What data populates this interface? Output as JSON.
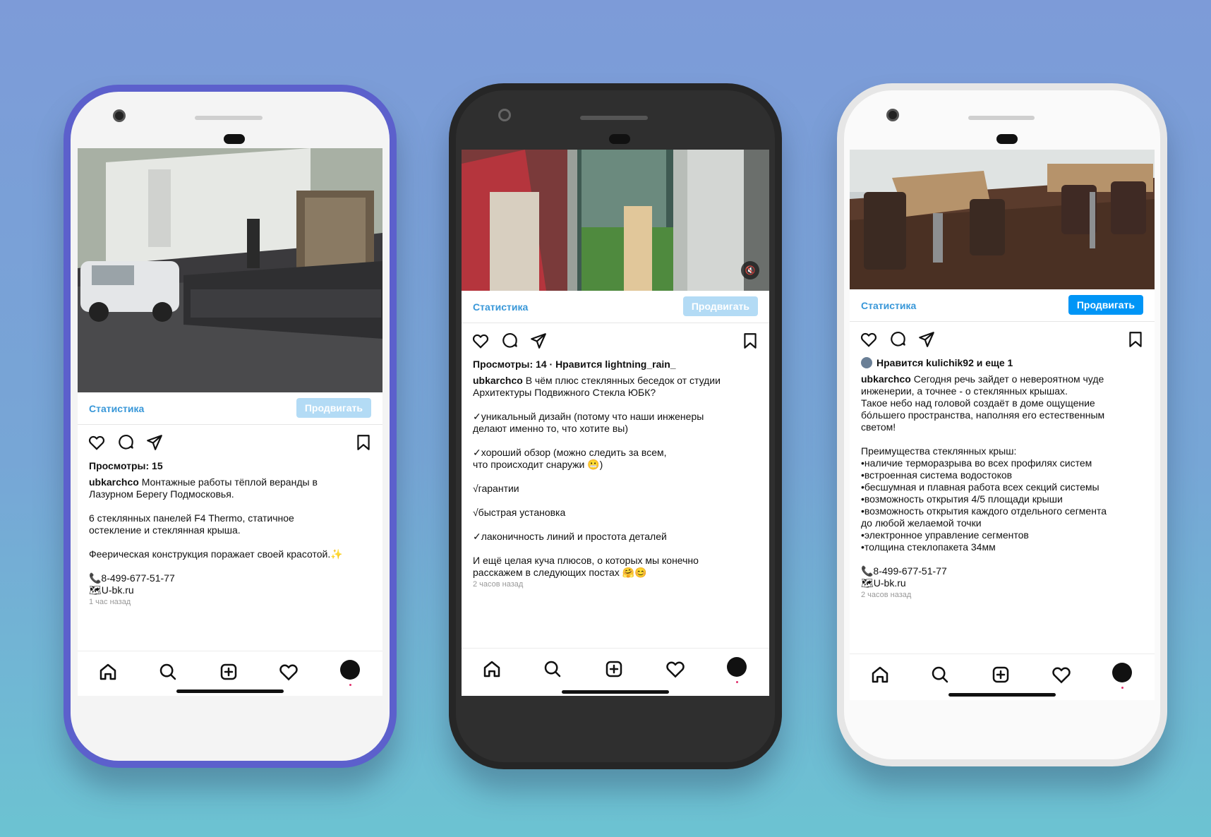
{
  "phones": [
    {
      "stat_label": "Статистика",
      "promote_label": "Продвигать",
      "views": "Просмотры: 15",
      "caption": [
        {
          "user": "ubkarchco",
          "text": " Монтажные работы тёплой веранды в"
        },
        {
          "text": "Лазурном Берегу Подмосковья."
        },
        {
          "text": ""
        },
        {
          "text": "6 стеклянных панелей F4 Thermo, статичное"
        },
        {
          "text": "остекление и стеклянная крыша."
        },
        {
          "text": ""
        },
        {
          "text": "Феерическая конструкция поражает своей красотой.✨"
        },
        {
          "text": ""
        },
        {
          "text": "📞8-499-677-51-77"
        },
        {
          "text": "🗺U-bk.ru"
        }
      ],
      "time": "1 час назад"
    },
    {
      "stat_label": "Статистика",
      "promote_label": "Продвигать",
      "views": "Просмотры: 14 · Нравится lightning_rain_",
      "caption": [
        {
          "user": "ubkarchco",
          "text": " В чём плюс стеклянных беседок от студии"
        },
        {
          "text": "Архитектуры Подвижного Стекла ЮБК?"
        },
        {
          "text": ""
        },
        {
          "text": "✓уникальный дизайн (потому что наши инженеры"
        },
        {
          "text": "делают именно то, что хотите вы)"
        },
        {
          "text": ""
        },
        {
          "text": "✓хороший обзор (можно следить за всем,"
        },
        {
          "text": " что происходит снаружи 😬)"
        },
        {
          "text": ""
        },
        {
          "text": "√гарантии"
        },
        {
          "text": ""
        },
        {
          "text": "√быстрая установка"
        },
        {
          "text": ""
        },
        {
          "text": "✓лаконичность линий и простота деталей"
        },
        {
          "text": ""
        },
        {
          "text": "И ещё целая куча плюсов, о которых мы конечно"
        },
        {
          "text": "расскажем  в следующих постах 🤗😊"
        }
      ],
      "time": "2 часов назад"
    },
    {
      "stat_label": "Статистика",
      "promote_label": "Продвигать",
      "likes": "Нравится kulichik92 и еще 1",
      "caption": [
        {
          "user": "ubkarchco",
          "text": " Сегодня речь зайдет о невероятном чуде"
        },
        {
          "text": "инженерии, а точнее - о стеклянных крышах."
        },
        {
          "text": "Такое небо над головой создаёт в доме ощущение"
        },
        {
          "text": "бóльшего пространства,  наполняя его естественным"
        },
        {
          "text": "светом!"
        },
        {
          "text": ""
        },
        {
          "text": "Преимущества стеклянных крыш:"
        },
        {
          "text": "•наличие терморазрыва во всех профилях систем"
        },
        {
          "text": "•встроенная система водостоков"
        },
        {
          "text": "•бесшумная и плавная работа всех секций системы"
        },
        {
          "text": "•возможность открытия 4/5 площади крыши"
        },
        {
          "text": "•возможность открытия каждого отдельного сегмента"
        },
        {
          "text": "до любой желаемой точки"
        },
        {
          "text": "•электронное управление сегментов"
        },
        {
          "text": "•толщина стеклопакета 34мм"
        },
        {
          "text": ""
        },
        {
          "text": "📞8-499-677-51-77"
        },
        {
          "text": "🗺U-bk.ru"
        }
      ],
      "time": "2 часов назад"
    }
  ],
  "colors": {
    "link": "#3897d8",
    "promote_disabled": "#b3dbf5",
    "promote_active": "#0095f6",
    "phone1_frame": "#5a5fc9",
    "phone2_frame": "#2a2a2a",
    "phone3_frame": "#e8e8e8"
  },
  "icons": [
    "heart-icon",
    "comment-icon",
    "share-icon",
    "bookmark-icon",
    "home-icon",
    "search-icon",
    "add-post-icon",
    "activity-icon",
    "profile-avatar",
    "mute-icon"
  ]
}
